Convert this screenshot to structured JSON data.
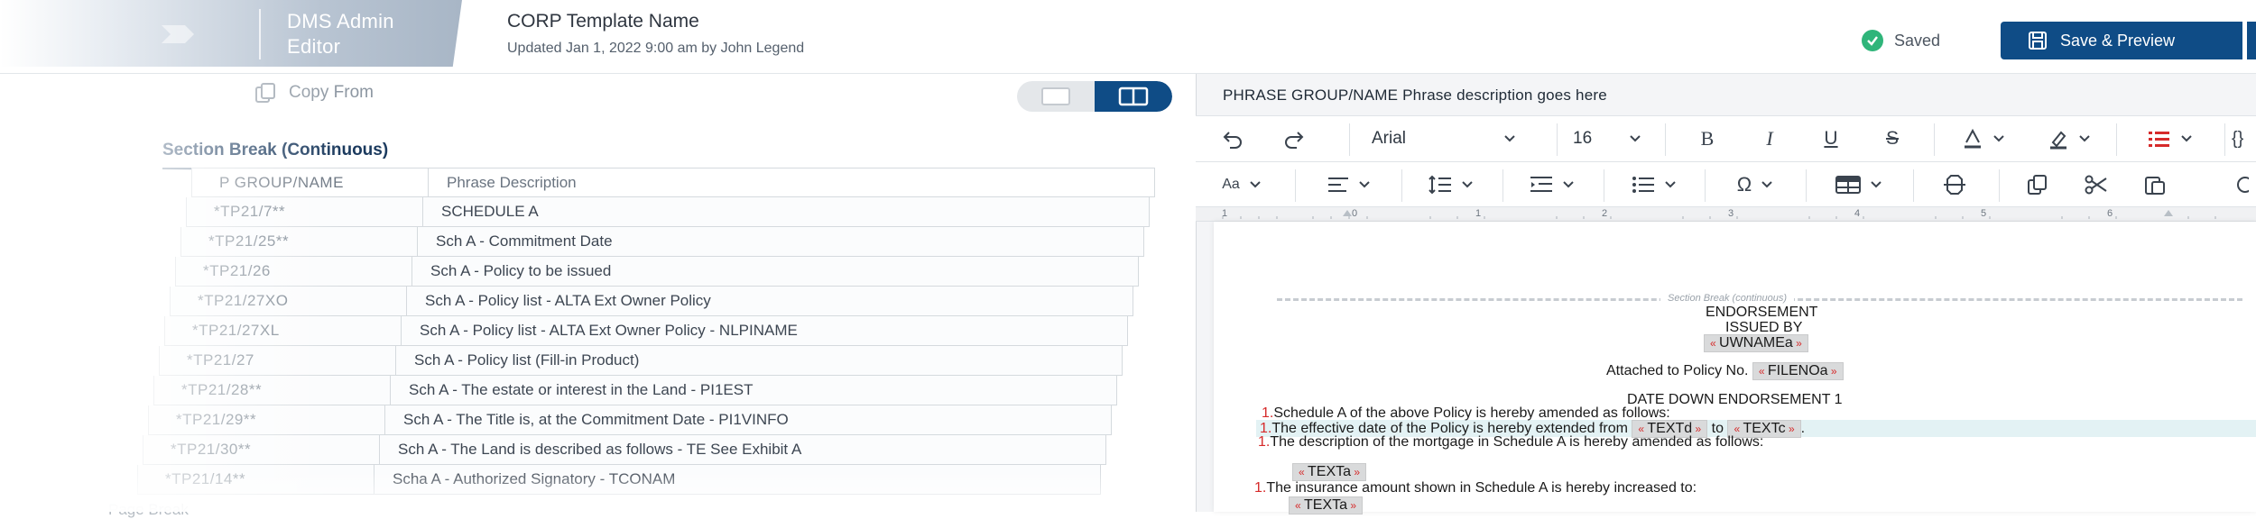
{
  "header": {
    "brand_title": "DMS Admin Editor",
    "doc_title": "CORP Template Name",
    "updated": "Updated Jan 1, 2022 9:00 am by John Legend",
    "saved_label": "Saved",
    "save_button_label": "Save & Preview"
  },
  "left_pane": {
    "toolbar_faint_label": "",
    "copy_from_label": "Copy From",
    "section_title": "Section Break (Continuous)",
    "columns": [
      "P GROUP/NAME",
      "Phrase Description"
    ],
    "rows": [
      [
        "*TP21/7**",
        "SCHEDULE A"
      ],
      [
        "*TP21/25**",
        "Sch A - Commitment Date"
      ],
      [
        "*TP21/26",
        "Sch A - Policy to be issued"
      ],
      [
        "*TP21/27XO",
        "Sch A - Policy list - ALTA Ext Owner Policy"
      ],
      [
        "*TP21/27XL",
        "Sch A - Policy list - ALTA Ext Owner Policy - NLPINAME"
      ],
      [
        "*TP21/27",
        "Sch A - Policy list (Fill-in Product)"
      ],
      [
        "*TP21/28**",
        "Sch A - The estate or interest in the Land - PI1EST"
      ],
      [
        "*TP21/29**",
        "Sch A - The Title is, at the Commitment Date - PI1VINFO"
      ],
      [
        "*TP21/30**",
        "Sch A - The Land is described as follows - TE See Exhibit A"
      ],
      [
        "*TP21/14**",
        "Scha A - Authorized Signatory - TCONAM"
      ]
    ],
    "footer_faint": "Page Break"
  },
  "editor": {
    "phrase_heading": "PHRASE GROUP/NAME Phrase description goes here",
    "font_family": "Arial",
    "font_size": "16",
    "style_label": "Aa",
    "ruler_numbers": [
      "1",
      "0",
      "1",
      "2",
      "3",
      "4",
      "5",
      "6"
    ],
    "section_break_label": "Section Break (continuous)",
    "doc_lines": {
      "endorsement": "ENDORSEMENT",
      "issued_by": "ISSUED BY",
      "uwname": "UWNAMEa",
      "attached": "Attached to Policy No.",
      "fileno": "FILENOa",
      "date_down": "DATE DOWN ENDORSEMENT 1",
      "item1": "Schedule A of the above Policy is hereby amended as follows:",
      "item2_a": "The effective date of the Policy is hereby extended from",
      "textd": "TEXTd",
      "to": "to",
      "textc": "TEXTc",
      "period": ".",
      "item3": "The description of the mortgage in Schedule A is hereby amended as follows:",
      "texta1": "TEXTa",
      "item4": "The insurance amount shown in Schedule A is hereby increased to:",
      "texta2": "TEXTa",
      "marker": "1."
    }
  },
  "colors": {
    "primary": "#0f4c86",
    "saved_green": "#2fb57a",
    "field_marker": "#d62a2a"
  }
}
